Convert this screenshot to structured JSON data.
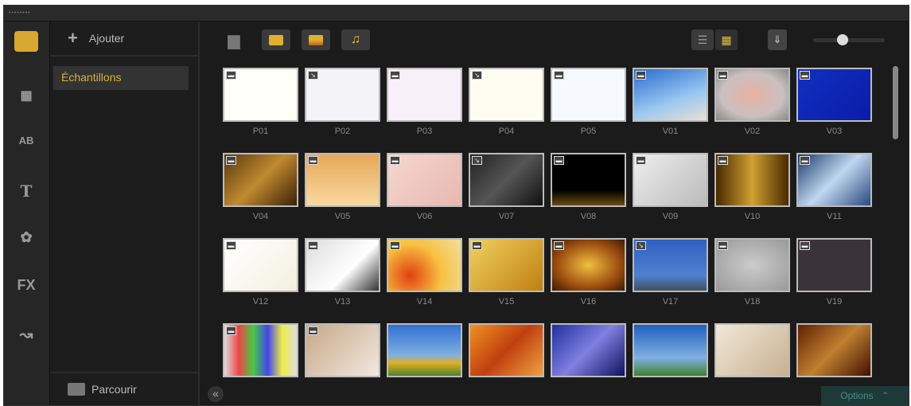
{
  "sidebar": {
    "add_label": "Ajouter",
    "folders": [
      {
        "label": "Échantillons"
      }
    ],
    "browse_label": "Parcourir"
  },
  "toolbar": {
    "zoom_fraction": 0.4
  },
  "options_label": "Options",
  "media": [
    {
      "label": "P01",
      "type": "image",
      "bg": "#fffef8"
    },
    {
      "label": "P02",
      "type": "transition",
      "bg": "#f4f4f6"
    },
    {
      "label": "P03",
      "type": "image",
      "bg": "#f8f0f8"
    },
    {
      "label": "P04",
      "type": "transition",
      "bg": "#fffdf2"
    },
    {
      "label": "P05",
      "type": "image",
      "bg": "#f6faff"
    },
    {
      "label": "V01",
      "type": "video",
      "bg": "linear-gradient(160deg,#2a6ad0,#9ac8f0 60%,#e8e0d0)"
    },
    {
      "label": "V02",
      "type": "video",
      "bg": "radial-gradient(#e8b0a0,#c9c0c0 60%,#888)"
    },
    {
      "label": "V03",
      "type": "video",
      "bg": "linear-gradient(135deg,#1030c0,#0a1ca8)"
    },
    {
      "label": "V04",
      "type": "video",
      "bg": "linear-gradient(135deg,#5a3a10,#c08a30,#3a2008)"
    },
    {
      "label": "V05",
      "type": "video",
      "bg": "linear-gradient(#e8a858,#f8d8a0)"
    },
    {
      "label": "V06",
      "type": "video",
      "bg": "linear-gradient(135deg,#f4d8d0,#e8b8b0)"
    },
    {
      "label": "V07",
      "type": "transition",
      "bg": "linear-gradient(135deg,#222,#555,#111)"
    },
    {
      "label": "V08",
      "type": "video",
      "bg": "linear-gradient(#000 70%,#6a4a10)"
    },
    {
      "label": "V09",
      "type": "video",
      "bg": "linear-gradient(135deg,#eee,#bbb)"
    },
    {
      "label": "V10",
      "type": "video",
      "bg": "linear-gradient(90deg,#4a2a00,#d0a030,#4a2a00)"
    },
    {
      "label": "V11",
      "type": "video",
      "bg": "linear-gradient(135deg,#1a3a6a,#c0d8f0,#2a4a80)"
    },
    {
      "label": "V12",
      "type": "video",
      "bg": "linear-gradient(135deg,#fff,#f4f0e0)"
    },
    {
      "label": "V13",
      "type": "video",
      "bg": "linear-gradient(135deg,#ddd,#fff 60%,#333)"
    },
    {
      "label": "V14",
      "type": "video",
      "bg": "radial-gradient(circle at 30% 70%,#e04010,#f8c040 50%,#f0e0a0)"
    },
    {
      "label": "V15",
      "type": "video",
      "bg": "linear-gradient(135deg,#f0d060,#c08010)"
    },
    {
      "label": "V16",
      "type": "video",
      "bg": "radial-gradient(#f0c040,#a05010 60%,#3a1a00)"
    },
    {
      "label": "V17",
      "type": "transition",
      "bg": "linear-gradient(#3060c0,#5080d0 70%,#405060)"
    },
    {
      "label": "V18",
      "type": "video",
      "bg": "radial-gradient(#ccc,#999)"
    },
    {
      "label": "V19",
      "type": "video",
      "bg": "#3a3438"
    },
    {
      "label": "",
      "type": "video",
      "bg": "linear-gradient(90deg,#ddd,#e44,#4c4,#44e,#ee4,#ddd)"
    },
    {
      "label": "",
      "type": "video",
      "bg": "linear-gradient(135deg,#c8a888,#f0e8e0)"
    },
    {
      "label": "",
      "type": "none",
      "bg": "linear-gradient(#3070d0,#80b0e0 60%,#e0b020 75%,#508030)"
    },
    {
      "label": "",
      "type": "none",
      "bg": "linear-gradient(135deg,#f09020,#c04010,#f0a040)"
    },
    {
      "label": "",
      "type": "none",
      "bg": "linear-gradient(135deg,#2030a0,#8080e0,#101060)"
    },
    {
      "label": "",
      "type": "none",
      "bg": "linear-gradient(#2060c0,#80b0e0 65%,#408030)"
    },
    {
      "label": "",
      "type": "none",
      "bg": "linear-gradient(135deg,#f0e8d8,#c8b090)"
    },
    {
      "label": "",
      "type": "none",
      "bg": "linear-gradient(135deg,#602000,#c08030,#401000)"
    }
  ]
}
